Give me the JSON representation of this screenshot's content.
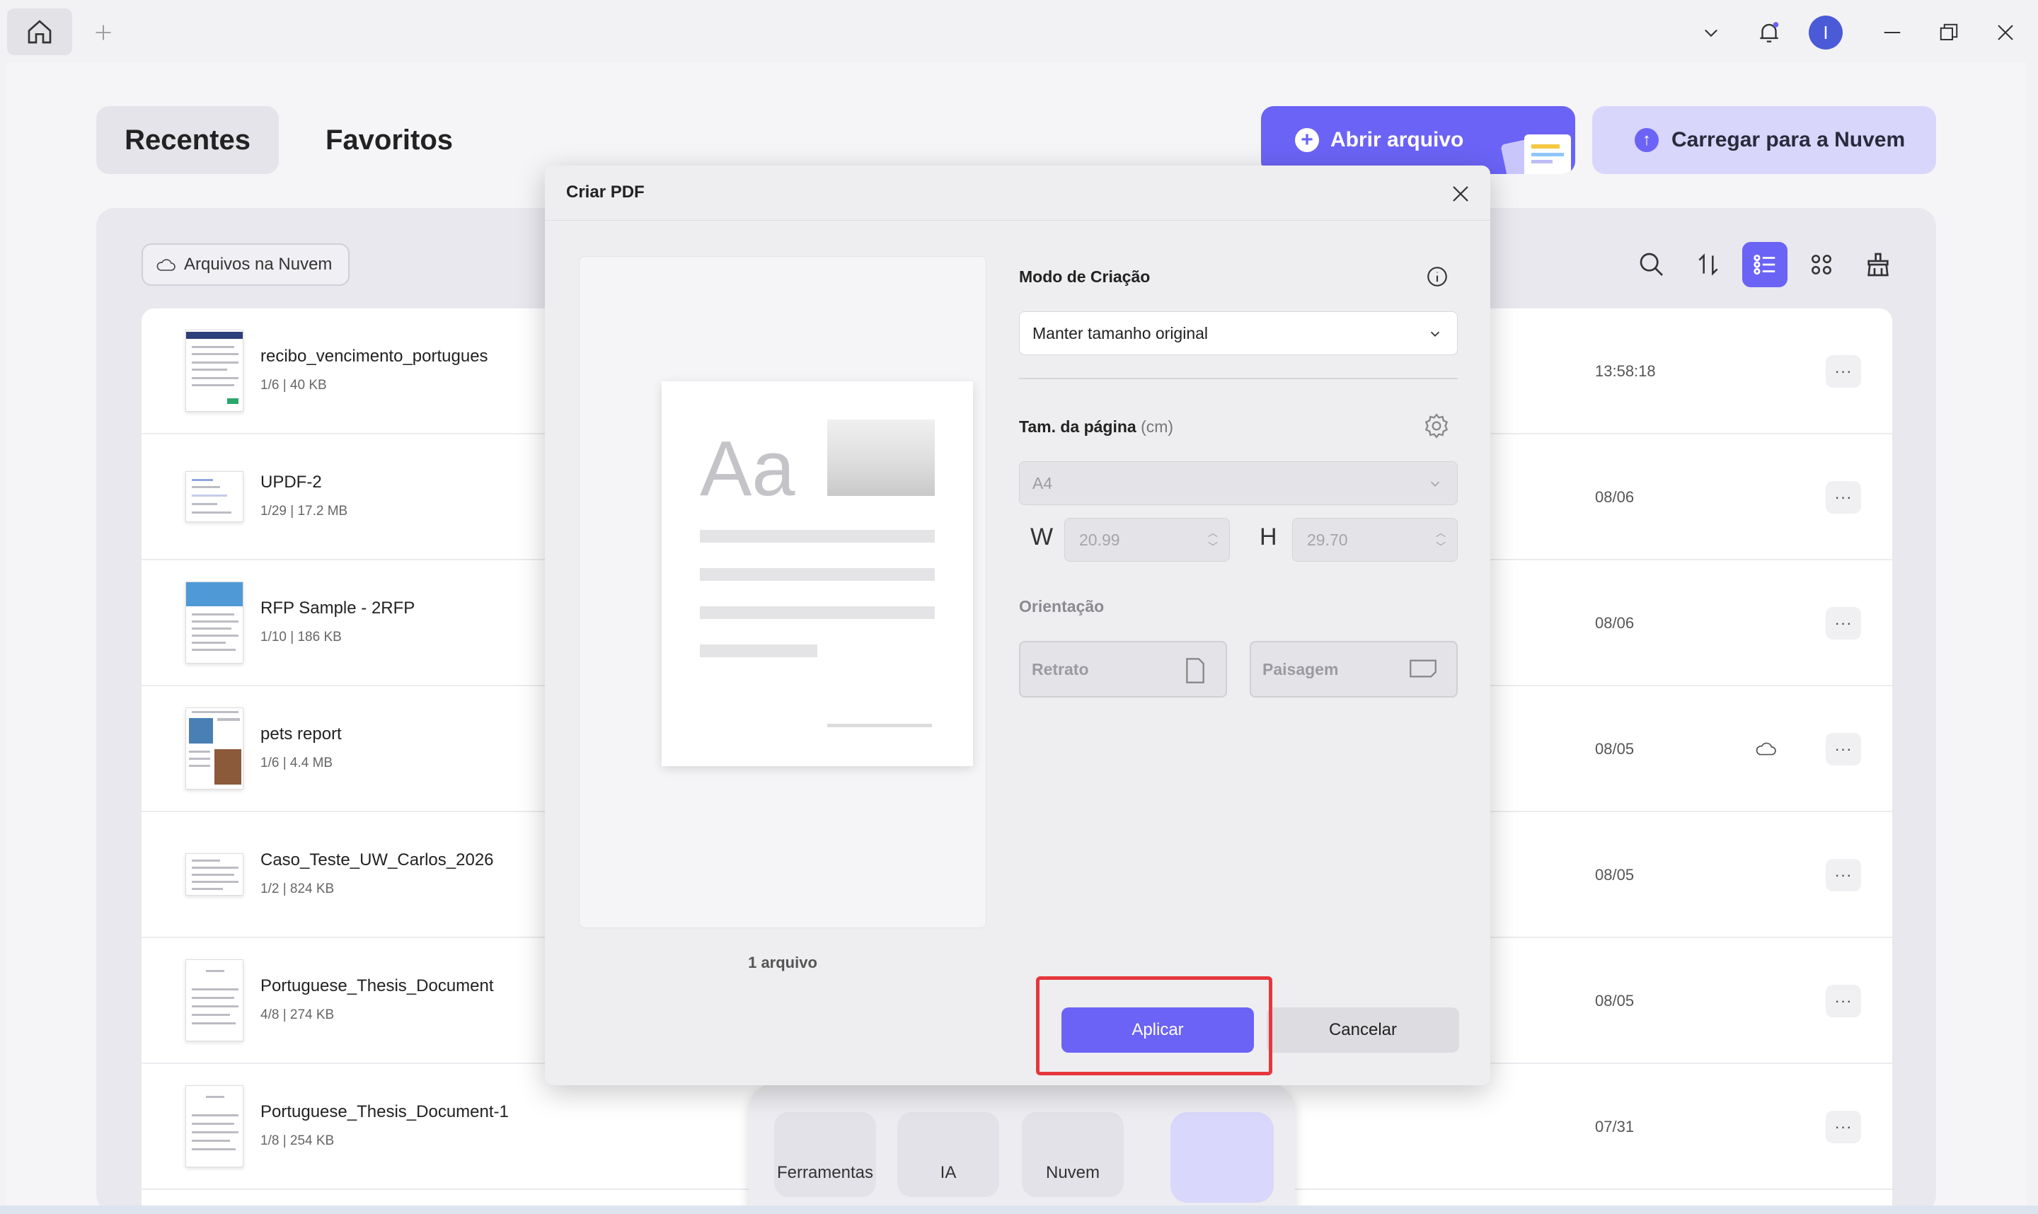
{
  "tabs": {
    "recent": "Recentes",
    "favorites": "Favoritos"
  },
  "actions": {
    "open_file": "Abrir arquivo",
    "upload_cloud": "Carregar para a Nuvem"
  },
  "cloud_filter": "Arquivos na Nuvem",
  "avatar_letter": "I",
  "files": [
    {
      "name": "recibo_vencimento_portugues",
      "meta": "1/6 | 40 KB",
      "date": "13:58:18",
      "cloud": false
    },
    {
      "name": "UPDF-2",
      "meta": "1/29 | 17.2 MB",
      "date": "08/06",
      "cloud": false
    },
    {
      "name": "RFP Sample - 2RFP",
      "meta": "1/10 | 186 KB",
      "date": "08/06",
      "cloud": false
    },
    {
      "name": "pets report",
      "meta": "1/6 | 4.4 MB",
      "date": "08/05",
      "cloud": true
    },
    {
      "name": "Caso_Teste_UW_Carlos_2026",
      "meta": "1/2 | 824 KB",
      "date": "08/05",
      "cloud": false
    },
    {
      "name": "Portuguese_Thesis_Document",
      "meta": "4/8 | 274 KB",
      "date": "08/05",
      "cloud": false
    },
    {
      "name": "Portuguese_Thesis_Document-1",
      "meta": "1/8 | 254 KB",
      "date": "07/31",
      "cloud": false
    }
  ],
  "more_label": "···",
  "dock": {
    "tools": "Ferramentas",
    "ai": "IA",
    "cloud": "Nuvem"
  },
  "modal": {
    "title": "Criar PDF",
    "preview_text": "Aa",
    "file_count": "1 arquivo",
    "creation_mode_label": "Modo de Criação",
    "creation_mode_value": "Manter tamanho original",
    "page_size_label": "Tam. da página",
    "page_size_unit": "(cm)",
    "page_size_value": "A4",
    "width_letter": "W",
    "width_value": "20.99",
    "height_letter": "H",
    "height_value": "29.70",
    "orientation_label": "Orientação",
    "portrait": "Retrato",
    "landscape": "Paisagem",
    "apply": "Aplicar",
    "cancel": "Cancelar"
  },
  "colors": {
    "accent": "#6b63f5",
    "highlight": "#e5373d"
  }
}
